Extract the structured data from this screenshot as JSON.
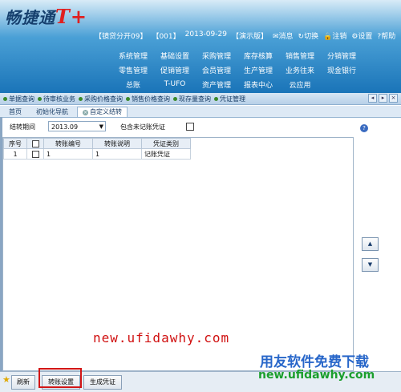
{
  "header": {
    "logo_text": "畅捷通",
    "logo_mark": "T+",
    "status": {
      "account": "【镜贷分开09】",
      "id": "【001】",
      "date": "2013-09-29",
      "edition": "【演示版】",
      "messages": "消息",
      "switch": "切换",
      "logout": "注销",
      "settings": "设置",
      "help": "帮助"
    },
    "menu_rows": [
      [
        "系统管理",
        "基础设置",
        "采购管理",
        "库存核算",
        "销售管理",
        "分销管理"
      ],
      [
        "零售管理",
        "促销管理",
        "会员管理",
        "生产管理",
        "业务往来",
        "现金银行"
      ],
      [
        "总账",
        "T-UFO",
        "资产管理",
        "报表中心",
        "云应用"
      ]
    ]
  },
  "quickbar": {
    "items": [
      "单据查询",
      "待审核业务",
      "采购价格查询",
      "销售价格查询",
      "现存量查询",
      "凭证管理"
    ]
  },
  "tabs": [
    {
      "label": "首页"
    },
    {
      "label": "初始化导航"
    },
    {
      "label": "自定义结转"
    }
  ],
  "filter": {
    "period_label": "结转期间",
    "period_value": "2013.09",
    "include_label": "包含未记账凭证"
  },
  "grid": {
    "headers": [
      "序号",
      "",
      "转账编号",
      "转账说明",
      "凭证类别"
    ],
    "rows": [
      {
        "no": "1",
        "code": "1",
        "desc": "1",
        "type": "记账凭证"
      }
    ]
  },
  "bottom": {
    "refresh": "刷新",
    "transfer_settings": "转账设置",
    "generate_voucher": "生成凭证"
  },
  "watermark": {
    "url_red": "new.ufidawhy.com",
    "blue": "用友软件免费下载",
    "green": "new.ufidawhy.com"
  }
}
